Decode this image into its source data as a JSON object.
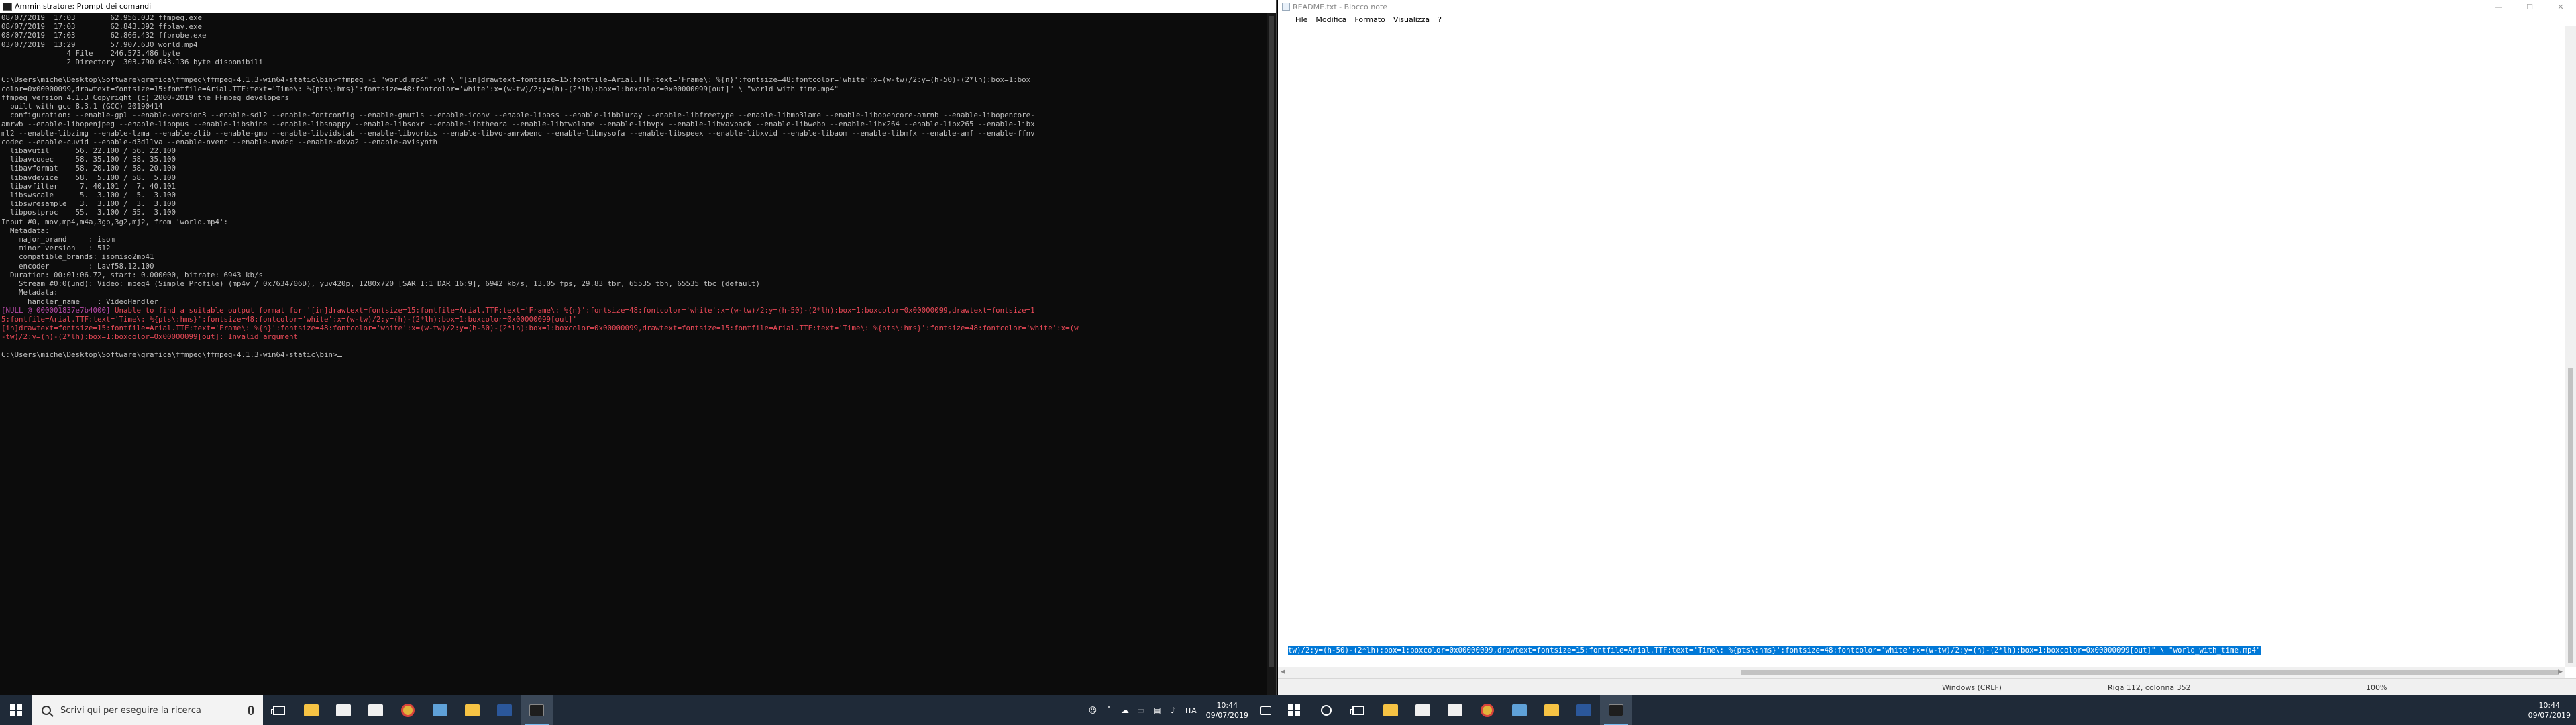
{
  "cmd": {
    "title": "Amministratore: Prompt dei comandi",
    "lines": [
      {
        "t": "08/07/2019  17:03        62.956.032 ffmpeg.exe",
        "c": ""
      },
      {
        "t": "08/07/2019  17:03        62.843.392 ffplay.exe",
        "c": ""
      },
      {
        "t": "08/07/2019  17:03        62.866.432 ffprobe.exe",
        "c": ""
      },
      {
        "t": "03/07/2019  13:29        57.907.630 world.mp4",
        "c": ""
      },
      {
        "t": "               4 File    246.573.486 byte",
        "c": ""
      },
      {
        "t": "               2 Directory  303.790.043.136 byte disponibili",
        "c": ""
      },
      {
        "t": "",
        "c": ""
      },
      {
        "t": "C:\\Users\\miche\\Desktop\\Software\\grafica\\ffmpeg\\ffmpeg-4.1.3-win64-static\\bin>ffmpeg -i \"world.mp4\" -vf \\ \"[in]drawtext=fontsize=15:fontfile=Arial.TTF:text='Frame\\: %{n}':fontsize=48:fontcolor='white':x=(w-tw)/2:y=(h-50)-(2*lh):box=1:box",
        "c": ""
      },
      {
        "t": "color=0x00000099,drawtext=fontsize=15:fontfile=Arial.TTF:text='Time\\: %{pts\\:hms}':fontsize=48:fontcolor='white':x=(w-tw)/2:y=(h)-(2*lh):box=1:boxcolor=0x00000099[out]\" \\ \"world_with_time.mp4\"",
        "c": ""
      },
      {
        "t": "ffmpeg version 4.1.3 Copyright (c) 2000-2019 the FFmpeg developers",
        "c": ""
      },
      {
        "t": "  built with gcc 8.3.1 (GCC) 20190414",
        "c": ""
      },
      {
        "t": "  configuration: --enable-gpl --enable-version3 --enable-sdl2 --enable-fontconfig --enable-gnutls --enable-iconv --enable-libass --enable-libbluray --enable-libfreetype --enable-libmp3lame --enable-libopencore-amrnb --enable-libopencore-",
        "c": ""
      },
      {
        "t": "amrwb --enable-libopenjpeg --enable-libopus --enable-libshine --enable-libsnappy --enable-libsoxr --enable-libtheora --enable-libtwolame --enable-libvpx --enable-libwavpack --enable-libwebp --enable-libx264 --enable-libx265 --enable-libx",
        "c": ""
      },
      {
        "t": "ml2 --enable-libzimg --enable-lzma --enable-zlib --enable-gmp --enable-libvidstab --enable-libvorbis --enable-libvo-amrwbenc --enable-libmysofa --enable-libspeex --enable-libxvid --enable-libaom --enable-libmfx --enable-amf --enable-ffnv",
        "c": ""
      },
      {
        "t": "codec --enable-cuvid --enable-d3d11va --enable-nvenc --enable-nvdec --enable-dxva2 --enable-avisynth",
        "c": ""
      },
      {
        "t": "  libavutil      56. 22.100 / 56. 22.100",
        "c": ""
      },
      {
        "t": "  libavcodec     58. 35.100 / 58. 35.100",
        "c": ""
      },
      {
        "t": "  libavformat    58. 20.100 / 58. 20.100",
        "c": ""
      },
      {
        "t": "  libavdevice    58.  5.100 / 58.  5.100",
        "c": ""
      },
      {
        "t": "  libavfilter     7. 40.101 /  7. 40.101",
        "c": ""
      },
      {
        "t": "  libswscale      5.  3.100 /  5.  3.100",
        "c": ""
      },
      {
        "t": "  libswresample   3.  3.100 /  3.  3.100",
        "c": ""
      },
      {
        "t": "  libpostproc    55.  3.100 / 55.  3.100",
        "c": ""
      },
      {
        "t": "Input #0, mov,mp4,m4a,3gp,3g2,mj2, from 'world.mp4':",
        "c": ""
      },
      {
        "t": "  Metadata:",
        "c": ""
      },
      {
        "t": "    major_brand     : isom",
        "c": ""
      },
      {
        "t": "    minor_version   : 512",
        "c": ""
      },
      {
        "t": "    compatible_brands: isomiso2mp41",
        "c": ""
      },
      {
        "t": "    encoder         : Lavf58.12.100",
        "c": ""
      },
      {
        "t": "  Duration: 00:01:06.72, start: 0.000000, bitrate: 6943 kb/s",
        "c": ""
      },
      {
        "t": "    Stream #0:0(und): Video: mpeg4 (Simple Profile) (mp4v / 0x7634706D), yuv420p, 1280x720 [SAR 1:1 DAR 16:9], 6942 kb/s, 13.05 fps, 29.83 tbr, 65535 tbn, 65535 tbc (default)",
        "c": ""
      },
      {
        "t": "    Metadata:",
        "c": ""
      },
      {
        "t": "      handler_name    : VideoHandler",
        "c": ""
      },
      {
        "t": "[NULL @ 000001837e7b4000] Unable to find a suitable output format for '[in]drawtext=fontsize=15:fontfile=Arial.TTF:text='Frame\\: %{n}':fontsize=48:fontcolor='white':x=(w-tw)/2:y=(h-50)-(2*lh):box=1:boxcolor=0x00000099,drawtext=fontsize=1",
        "c": "mixed"
      },
      {
        "t": "5:fontfile=Arial.TTF:text='Time\\: %{pts\\:hms}':fontsize=48:fontcolor='white':x=(w-tw)/2:y=(h)-(2*lh):box=1:boxcolor=0x00000099[out]'",
        "c": "err"
      },
      {
        "t": "[in]drawtext=fontsize=15:fontfile=Arial.TTF:text='Frame\\: %{n}':fontsize=48:fontcolor='white':x=(w-tw)/2:y=(h-50)-(2*lh):box=1:boxcolor=0x00000099,drawtext=fontsize=15:fontfile=Arial.TTF:text='Time\\: %{pts\\:hms}':fontsize=48:fontcolor='white':x=(w",
        "c": "err"
      },
      {
        "t": "-tw)/2:y=(h)-(2*lh):box=1:boxcolor=0x00000099[out]: Invalid argument",
        "c": "err"
      },
      {
        "t": "",
        "c": ""
      },
      {
        "t": "C:\\Users\\miche\\Desktop\\Software\\grafica\\ffmpeg\\ffmpeg-4.1.3-win64-static\\bin>",
        "c": "prompt"
      }
    ],
    "null_tag": "[NULL @ 000001837e7b4000]"
  },
  "notepad": {
    "title": "README.txt - Blocco note",
    "controls": {
      "minimize": "—",
      "maximize": "☐",
      "close": "✕"
    },
    "menu": [
      "File",
      "Modifica",
      "Formato",
      "Visualizza",
      "?"
    ],
    "selected_line": "tw)/2:y=(h-50)-(2*lh):box=1:boxcolor=0x00000099,drawtext=fontsize=15:fontfile=Arial.TTF:text='Time\\: %{pts\\:hms}':fontsize=48:fontcolor='white':x=(w-tw)/2:y=(h)-(2*lh):box=1:boxcolor=0x00000099[out]\" \\ \"world_with_time.mp4\"",
    "status": {
      "encoding": "Windows (CRLF)",
      "position": "Riga 112, colonna 352",
      "zoom": "100%"
    }
  },
  "taskbar_left": {
    "search_placeholder": "Scrivi qui per eseguire la ricerca",
    "apps": [
      {
        "name": "task-view-icon",
        "color": ""
      },
      {
        "name": "file-explorer-icon",
        "color": "#f6c344"
      },
      {
        "name": "store-icon",
        "color": "#f0f0f0"
      },
      {
        "name": "mail-icon",
        "color": "#f0f0f0"
      },
      {
        "name": "chrome-icon",
        "color": "#e0b43b"
      },
      {
        "name": "app-icon",
        "color": "#5fa1d8"
      },
      {
        "name": "folder-icon",
        "color": "#f6c344"
      },
      {
        "name": "word-icon",
        "color": "#2b579a"
      },
      {
        "name": "cmd-icon",
        "color": "#1e1e1e"
      }
    ],
    "lang": "ITA",
    "time": "10:44",
    "date": "09/07/2019"
  },
  "taskbar_right": {
    "apps": [
      {
        "name": "task-view-icon",
        "color": ""
      },
      {
        "name": "file-explorer-icon",
        "color": "#f6c344"
      },
      {
        "name": "store-icon",
        "color": "#f0f0f0"
      },
      {
        "name": "mail-icon",
        "color": "#f0f0f0"
      },
      {
        "name": "chrome-icon",
        "color": "#e0b43b"
      },
      {
        "name": "app-icon",
        "color": "#5fa1d8"
      },
      {
        "name": "folder-icon",
        "color": "#f6c344"
      },
      {
        "name": "word-icon",
        "color": "#2b579a"
      },
      {
        "name": "cmd-icon",
        "color": "#1e1e1e"
      }
    ],
    "time": "10:44",
    "date": "09/07/2019"
  },
  "colors": {
    "cmd_bg": "#0c0c0c",
    "cmd_text": "#c0c0c0",
    "cmd_error": "#e74856",
    "cmd_tag": "#b648a6",
    "selection": "#0078d7",
    "taskbar": "#1f2a38"
  }
}
